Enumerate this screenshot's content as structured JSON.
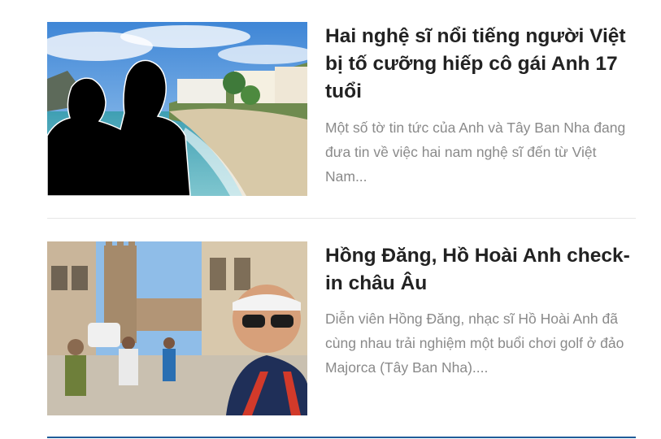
{
  "articles": [
    {
      "title": "Hai nghệ sĩ nổi tiếng người Việt bị tố cưỡng hiếp cô gái Anh 17 tuổi",
      "excerpt": "Một số tờ tin tức của Anh và Tây Ban Nha đang đưa tin về việc hai nam nghệ sĩ đến từ Việt Nam...",
      "thumbnail_icon": "beach-silhouettes-photo"
    },
    {
      "title": "Hồng Đăng, Hồ Hoài Anh check-in châu Âu",
      "excerpt": "Diễn viên Hồng Đăng, nhạc sĩ Hồ Hoài Anh đã cùng nhau trải nghiệm một buổi chơi golf ở đảo Majorca (Tây Ban Nha)....",
      "thumbnail_icon": "selfie-street-photo"
    }
  ],
  "colors": {
    "title": "#222222",
    "excerpt": "#8a8a8a",
    "divider": "#e6e6e6",
    "accent_rule": "#1f5d99"
  }
}
